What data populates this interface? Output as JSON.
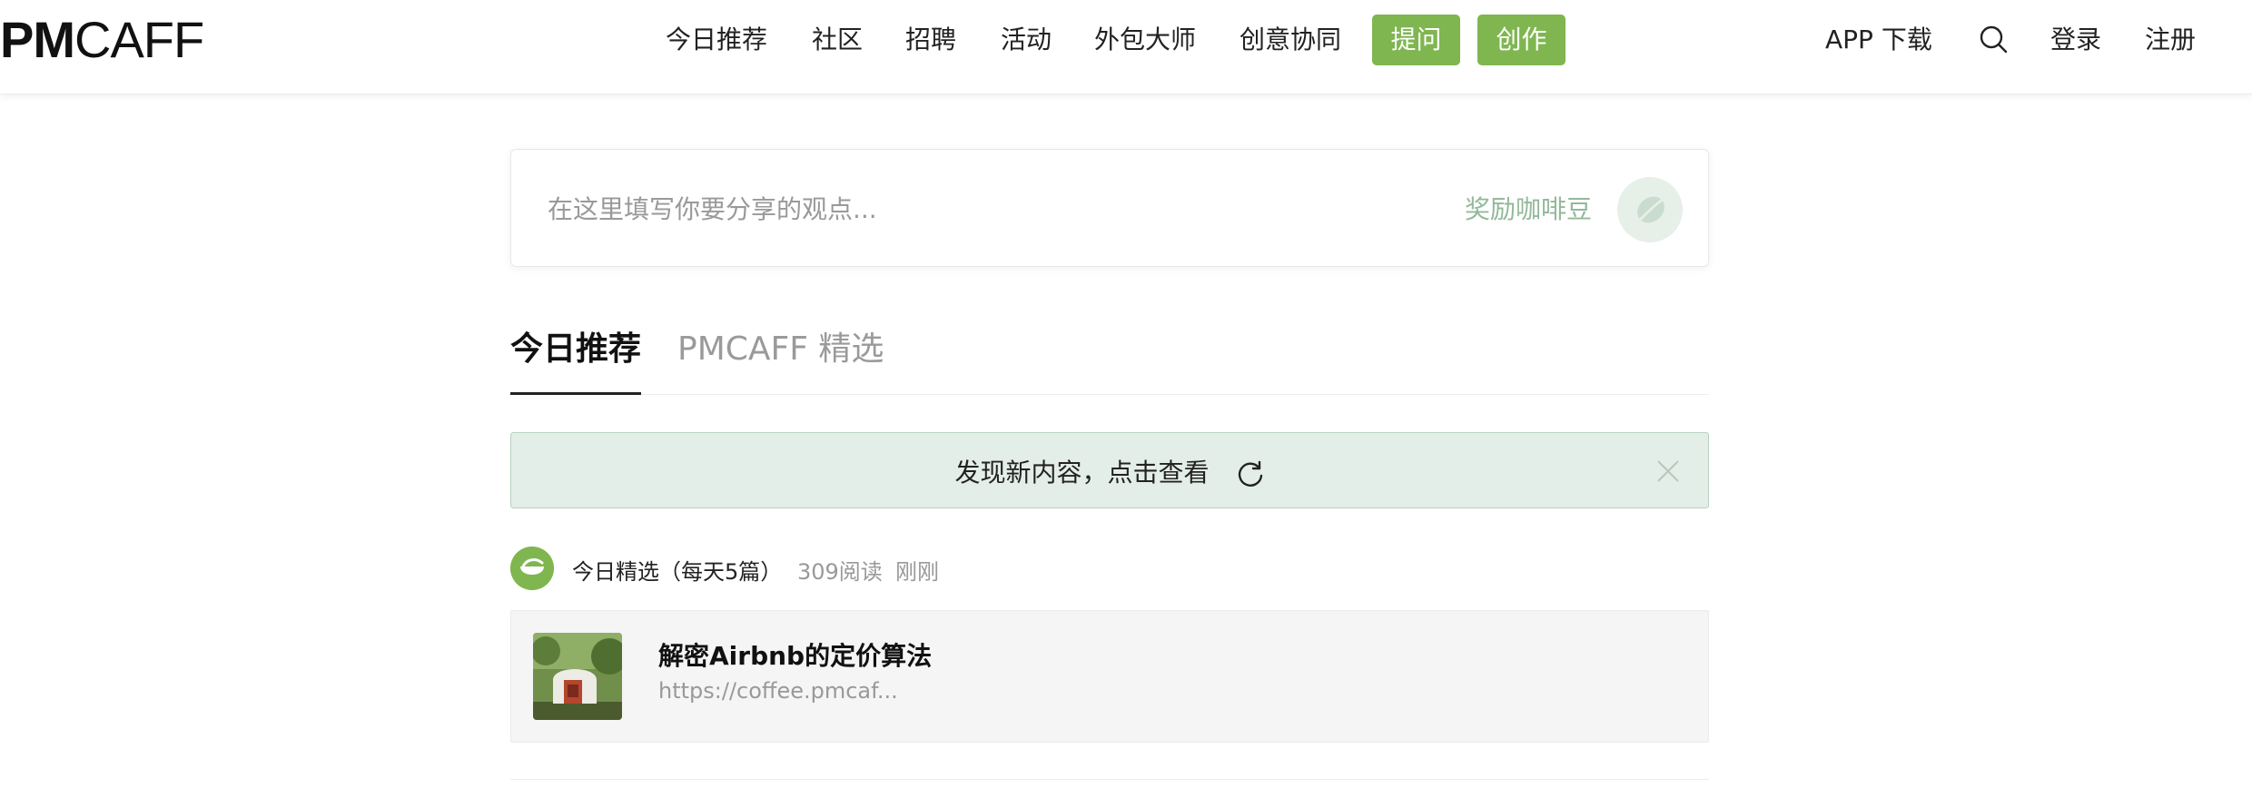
{
  "header": {
    "logo": {
      "bold": "PM",
      "regular": "CAFF"
    },
    "nav": [
      "今日推荐",
      "社区",
      "招聘",
      "活动",
      "外包大师",
      "创意协同"
    ],
    "ask_button": "提问",
    "create_button": "创作",
    "app_download": "APP 下载",
    "login": "登录",
    "register": "注册",
    "accent_color": "#7fb650"
  },
  "composer": {
    "placeholder": "在这里填写你要分享的观点...",
    "reward_label": "奖励咖啡豆"
  },
  "tabs": [
    {
      "label": "今日推荐",
      "active": true
    },
    {
      "label": "PMCAFF 精选",
      "active": false
    }
  ],
  "notice": {
    "text": "发现新内容，点击查看"
  },
  "feed": {
    "source": "今日精选（每天5篇）",
    "reads": "309阅读",
    "time": "刚刚",
    "article": {
      "title": "解密Airbnb的定价算法",
      "url": "https://coffee.pmcaf..."
    }
  }
}
